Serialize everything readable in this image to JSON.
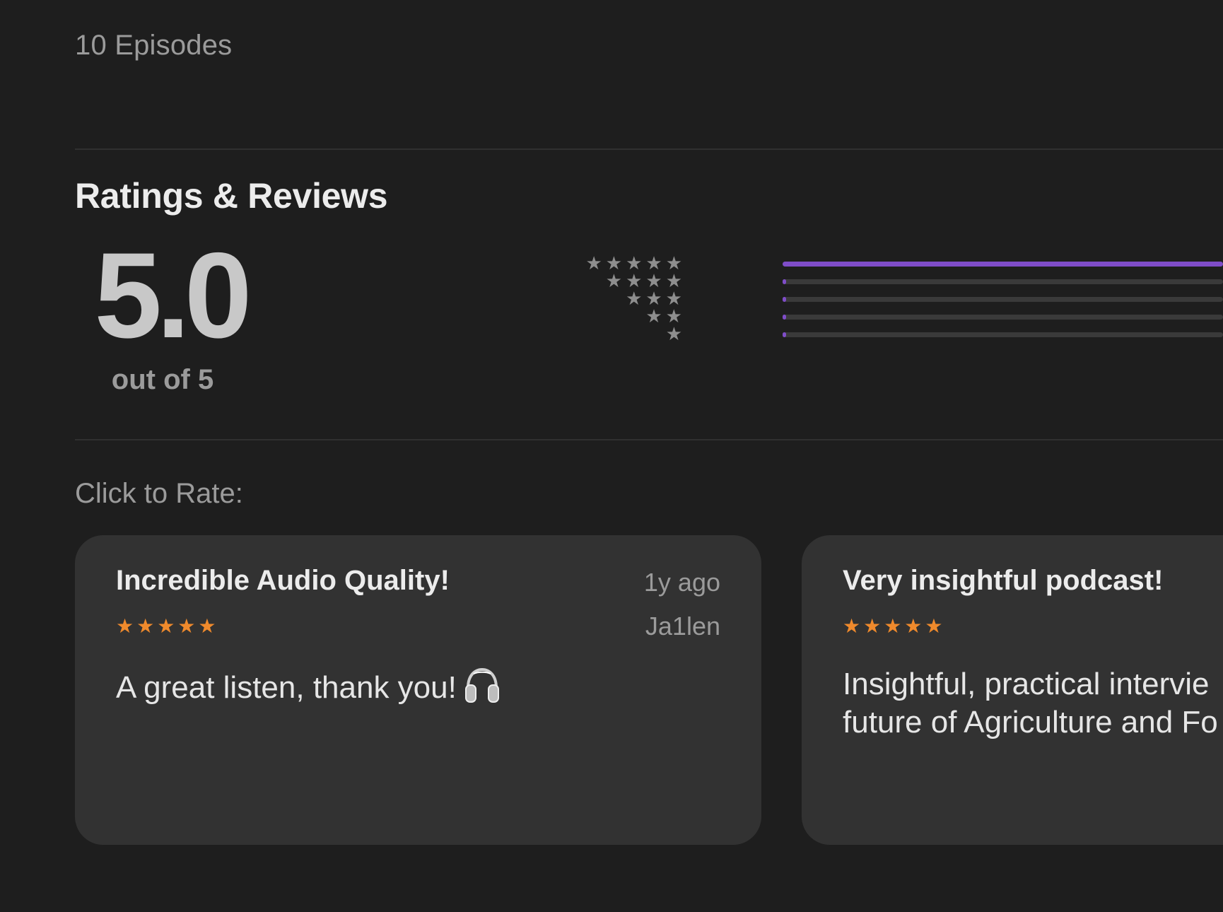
{
  "episodes_label": "10 Episodes",
  "ratings": {
    "title": "Ratings & Reviews",
    "average": "5.0",
    "out_of": "out of 5",
    "distribution": [
      {
        "stars": 5,
        "star_glyphs": "★★★★★",
        "fraction": 1.0
      },
      {
        "stars": 4,
        "star_glyphs": "★★★★",
        "fraction": 0.0
      },
      {
        "stars": 3,
        "star_glyphs": "★★★",
        "fraction": 0.0
      },
      {
        "stars": 2,
        "star_glyphs": "★★",
        "fraction": 0.0
      },
      {
        "stars": 1,
        "star_glyphs": "★",
        "fraction": 0.0
      }
    ]
  },
  "click_to_rate": "Click to Rate:",
  "reviews": [
    {
      "title": "Incredible Audio Quality!",
      "time": "1y ago",
      "author": "Ja1len",
      "rating": 5,
      "stars": "★★★★★",
      "body": "A great listen, thank you!",
      "icon": "headphones-icon"
    },
    {
      "title": "Very insightful podcast!",
      "rating": 5,
      "stars": "★★★★★",
      "body": "Insightful, practical intervie\nfuture of Agriculture and Fo"
    }
  ],
  "colors": {
    "background": "#1e1e1e",
    "card": "#323232",
    "accent_bar": "#7f4dc8",
    "star_orange": "#f08a2c"
  }
}
